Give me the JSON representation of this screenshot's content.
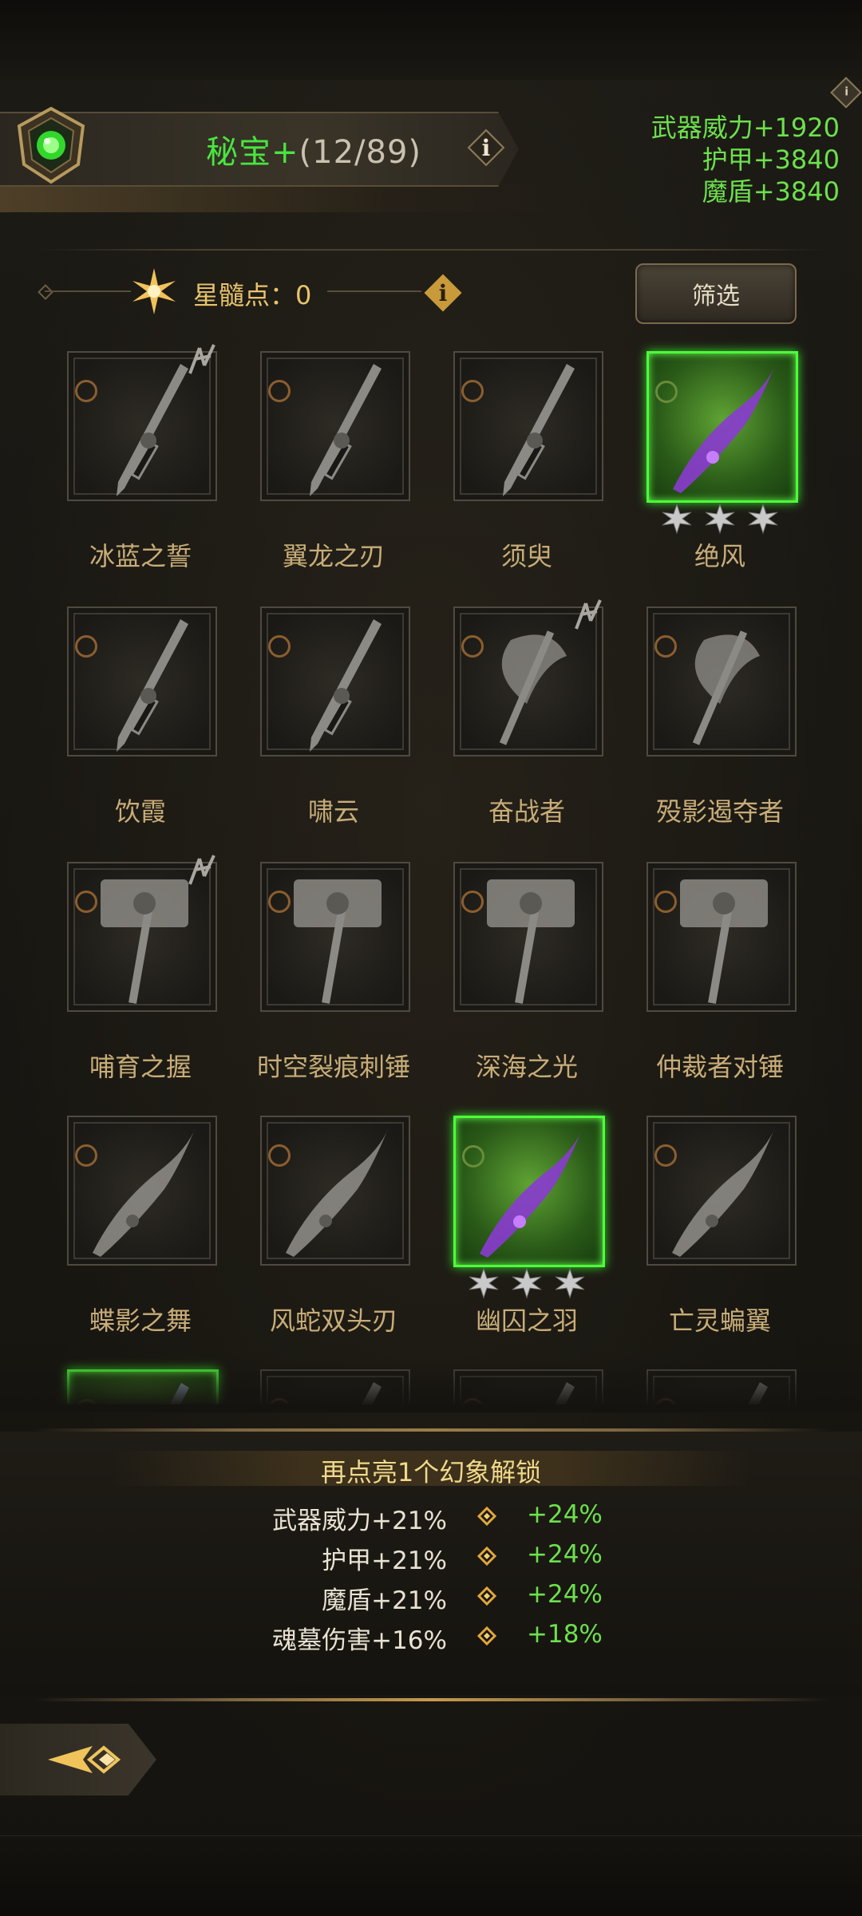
{
  "header": {
    "title_label": "秘宝+",
    "title_progress": "(12/89)",
    "info_glyph": "i"
  },
  "stats": [
    "武器威力+1920",
    "护甲+3840",
    "魔盾+3840"
  ],
  "star_points": {
    "label": "星髓点：0"
  },
  "filter": {
    "label": "筛选"
  },
  "items": [
    {
      "name": "冰蓝之誓",
      "unlocked": false,
      "stars": 0,
      "rune": true,
      "icon": "spiked-sword-icon"
    },
    {
      "name": "翼龙之刃",
      "unlocked": false,
      "stars": 0,
      "rune": false,
      "icon": "greatsword-icon"
    },
    {
      "name": "须臾",
      "unlocked": false,
      "stars": 0,
      "rune": false,
      "icon": "broadsword-icon"
    },
    {
      "name": "绝风",
      "unlocked": true,
      "stars": 3,
      "rune": false,
      "icon": "glowing-sword-icon"
    },
    {
      "name": "饮霞",
      "unlocked": false,
      "stars": 0,
      "rune": false,
      "icon": "serrated-sword-icon"
    },
    {
      "name": "啸云",
      "unlocked": false,
      "stars": 0,
      "rune": false,
      "icon": "wavy-sword-icon"
    },
    {
      "name": "奋战者",
      "unlocked": false,
      "stars": 0,
      "rune": true,
      "icon": "battle-axe-icon"
    },
    {
      "name": "殁影遏夺者",
      "unlocked": false,
      "stars": 0,
      "rune": false,
      "icon": "scythe-axe-icon"
    },
    {
      "name": "哺育之握",
      "unlocked": false,
      "stars": 0,
      "rune": true,
      "icon": "warhammer-icon"
    },
    {
      "name": "时空裂痕刺锤",
      "unlocked": false,
      "stars": 0,
      "rune": false,
      "icon": "spiked-hammer-icon"
    },
    {
      "name": "深海之光",
      "unlocked": false,
      "stars": 0,
      "rune": false,
      "icon": "skull-hammer-icon"
    },
    {
      "name": "仲裁者对锤",
      "unlocked": false,
      "stars": 0,
      "rune": false,
      "icon": "twin-maces-icon"
    },
    {
      "name": "蝶影之舞",
      "unlocked": false,
      "stars": 0,
      "rune": false,
      "icon": "curved-blade-icon"
    },
    {
      "name": "风蛇双头刃",
      "unlocked": false,
      "stars": 0,
      "rune": false,
      "icon": "double-blade-icon"
    },
    {
      "name": "幽囚之羽",
      "unlocked": true,
      "stars": 3,
      "rune": false,
      "icon": "purple-blade-icon"
    },
    {
      "name": "亡灵蝙翼",
      "unlocked": false,
      "stars": 0,
      "rune": false,
      "icon": "bone-wing-icon"
    },
    {
      "name": "",
      "unlocked": true,
      "stars": 0,
      "rune": false,
      "icon": "partial-card-icon"
    },
    {
      "name": "",
      "unlocked": false,
      "stars": 0,
      "rune": false,
      "icon": "partial-card-icon"
    },
    {
      "name": "",
      "unlocked": false,
      "stars": 0,
      "rune": false,
      "icon": "partial-card-icon"
    },
    {
      "name": "",
      "unlocked": false,
      "stars": 0,
      "rune": false,
      "icon": "partial-card-icon"
    }
  ],
  "unlock": {
    "title": "再点亮1个幻象解锁",
    "bonuses": [
      {
        "current": "武器威力+21%",
        "next": "+24%"
      },
      {
        "current": "护甲+21%",
        "next": "+24%"
      },
      {
        "current": "魔盾+21%",
        "next": "+24%"
      },
      {
        "current": "魂墓伤害+16%",
        "next": "+18%"
      }
    ]
  },
  "colors": {
    "accent_green": "#48e640",
    "stat_green": "#6ce04d",
    "gold": "#e8c46c",
    "item_name": "#c8ad78"
  },
  "back_button": {
    "icon": "back-arrow-icon"
  }
}
